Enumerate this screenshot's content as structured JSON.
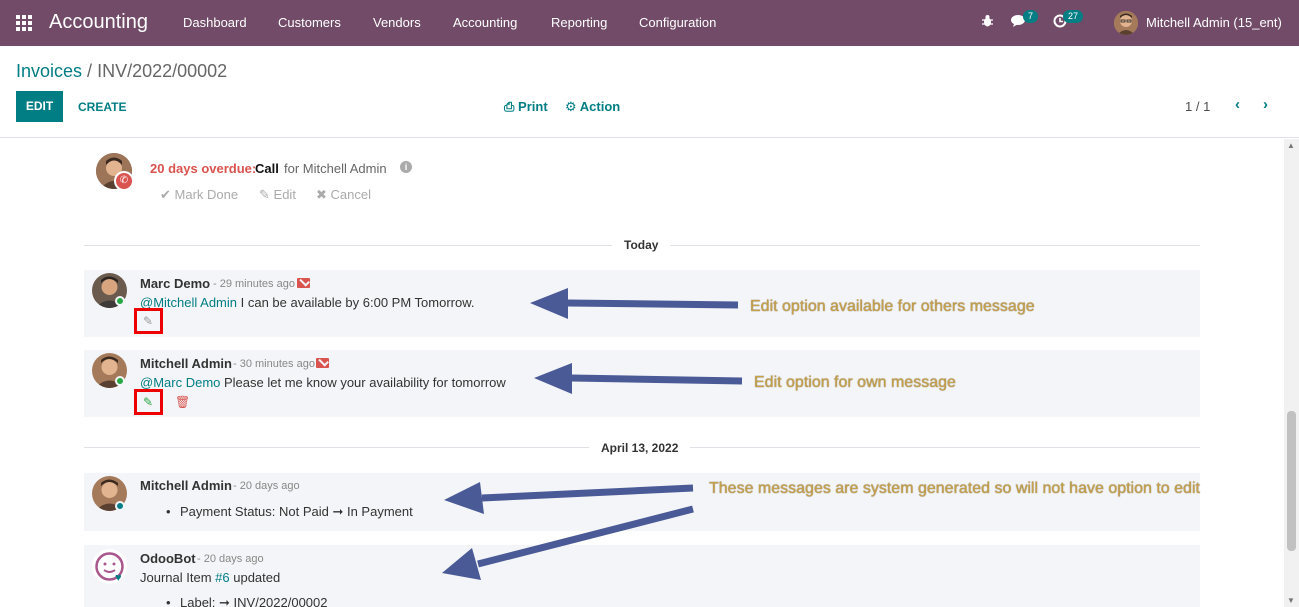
{
  "navbar": {
    "brand": "Accounting",
    "menus": [
      "Dashboard",
      "Customers",
      "Vendors",
      "Accounting",
      "Reporting",
      "Configuration"
    ],
    "messages_count": "7",
    "activities_count": "27",
    "user": "Mitchell Admin (15_ent)",
    "bg_color": "#714b67"
  },
  "control_panel": {
    "breadcrumb_parent": "Invoices",
    "breadcrumb_sep": " / ",
    "breadcrumb_current": "INV/2022/00002",
    "edit_label": "EDIT",
    "create_label": "CREATE",
    "print_label": "Print",
    "action_label": "Action",
    "pager": "1 / 1"
  },
  "activity": {
    "overdue": "20 days overdue:",
    "type": "Call",
    "assignee": "for Mitchell Admin",
    "mark_done": "Mark Done",
    "edit": "Edit",
    "cancel": "Cancel"
  },
  "separators": {
    "today": "Today",
    "older": "April 13, 2022"
  },
  "messages": [
    {
      "author": "Marc Demo",
      "date": "- 29 minutes ago",
      "mention": "@Mitchell Admin",
      "text": " I can be available by 6:00 PM Tomorrow."
    },
    {
      "author": "Mitchell Admin",
      "date": "- 30 minutes ago",
      "mention": "@Marc Demo",
      "text": " Please let me know your availability for tomorrow"
    },
    {
      "author": "Mitchell Admin",
      "date": "- 20 days ago",
      "tracking": "Payment Status: Not Paid ➞ In Payment"
    },
    {
      "author": "OdooBot",
      "date": "- 20 days ago",
      "text_prefix": "Journal Item ",
      "link": "#6",
      "text_suffix": " updated",
      "tracking": "Label: ➞ INV/2022/00002"
    }
  ],
  "annotations": {
    "others": "Edit option available for others message",
    "own": "Edit option for own message",
    "system": "These messages are system generated so will not have option to edit"
  },
  "colors": {
    "primary": "#017e84",
    "danger": "#d9534f",
    "highlight": "#ee0000",
    "arrow": "#4a5a96",
    "annotation_text": "#c7a04a"
  }
}
